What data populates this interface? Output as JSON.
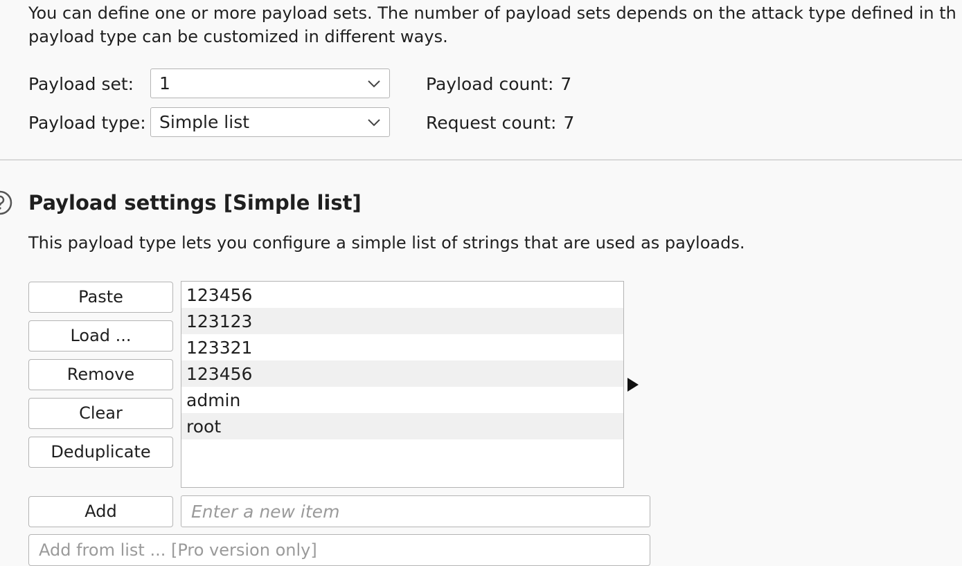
{
  "intro": {
    "line1": "You can define one or more payload sets. The number of payload sets depends on the attack type defined in th",
    "line2": "payload type can be customized in different ways."
  },
  "payload_set": {
    "label": "Payload set:",
    "value": "1"
  },
  "payload_type": {
    "label": "Payload type:",
    "value": "Simple list"
  },
  "counts": {
    "payload_label": "Payload count:",
    "payload_value": "7",
    "request_label": "Request count:",
    "request_value": "7"
  },
  "settings": {
    "title": "Payload settings [Simple list]",
    "description": "This payload type lets you configure a simple list of strings that are used as payloads."
  },
  "buttons": {
    "paste": "Paste",
    "load": "Load ...",
    "remove": "Remove",
    "clear": "Clear",
    "deduplicate": "Deduplicate",
    "add": "Add"
  },
  "list": {
    "items": [
      "123456",
      "123123",
      "123321",
      "123456",
      "admin",
      "root"
    ]
  },
  "new_item": {
    "value": "",
    "placeholder": "Enter a new item"
  },
  "add_from_list": {
    "label": "Add from list ... [Pro version only]"
  },
  "icons": {
    "dropdown": "chevron-down-icon",
    "help": "help-icon",
    "expand": "triangle-right-icon"
  }
}
